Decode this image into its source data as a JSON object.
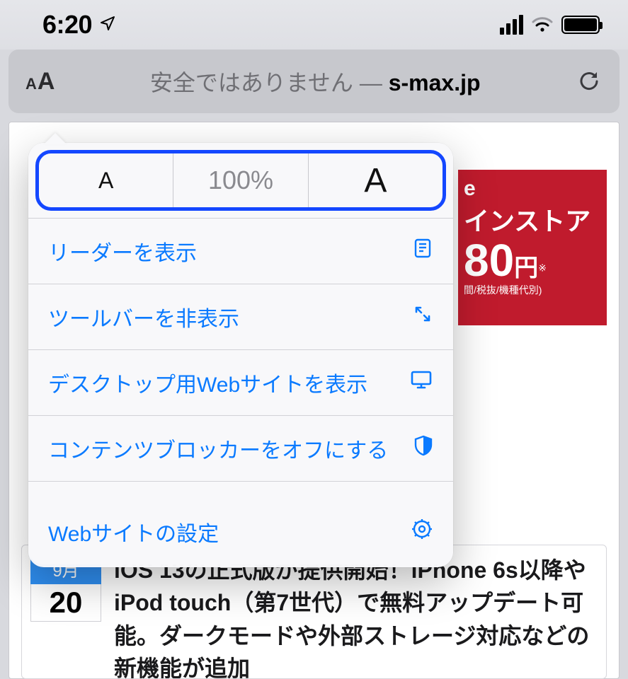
{
  "status": {
    "time": "6:20",
    "location_icon": "location-arrow-icon",
    "signal_bars": 4,
    "wifi_icon": "wifi-icon",
    "battery_icon": "battery-full-icon"
  },
  "urlbar": {
    "aa_icon": "text-size-aa-icon",
    "insecure_label": "安全ではありません",
    "dash": " — ",
    "domain": "s-max.jp",
    "reload_icon": "reload-icon"
  },
  "popover": {
    "zoom": {
      "decrease_label": "A",
      "percent_label": "100%",
      "increase_label": "A"
    },
    "items": [
      {
        "label": "リーダーを表示",
        "icon": "reader-icon"
      },
      {
        "label": "ツールバーを非表示",
        "icon": "expand-arrows-icon"
      },
      {
        "label": "デスクトップ用Webサイトを表示",
        "icon": "desktop-icon"
      },
      {
        "label": "コンテンツブロッカーをオフにする",
        "icon": "shield-half-icon"
      }
    ],
    "settings": {
      "label": "Webサイトの設定",
      "icon": "gear-outline-icon"
    }
  },
  "background_ad": {
    "partial_e": "e",
    "line1": "インストア",
    "price": "80",
    "yen": "円",
    "asterisk": "※",
    "note": "間/税抜/機種代別)"
  },
  "article": {
    "month": "9月",
    "day": "20",
    "title": "iOS 13の正式版が提供開始！iPhone 6s以降やiPod touch（第7世代）で無料アップデート可能。ダークモードや外部ストレージ対応などの新機能が追加"
  }
}
